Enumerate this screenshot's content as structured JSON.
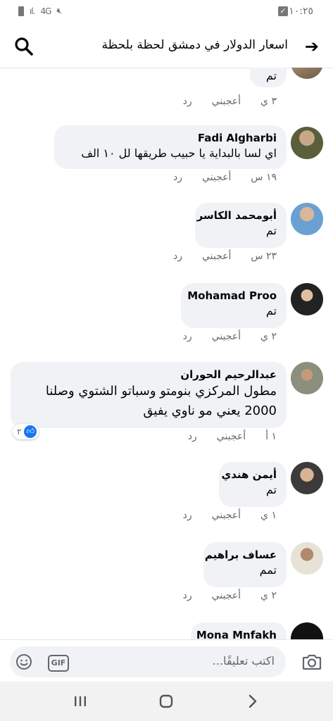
{
  "status": {
    "time": "١٠:٢٥",
    "network": "4G"
  },
  "header": {
    "title": "اسعار الدولار في دمشق لحظة بلحظة"
  },
  "comments": [
    {
      "name": "",
      "text": "تم",
      "time": "٣ ي",
      "like": "أعجبني",
      "reply": "رد"
    },
    {
      "name": "Fadi Algharbi",
      "text": "اي لسا بالبداية يا حبيب طريقها لل ١٠ الف",
      "time": "١٩ س",
      "like": "أعجبني",
      "reply": "رد"
    },
    {
      "name": "أبومحمد الكاسر",
      "text": "تم",
      "time": "٢٣ س",
      "like": "أعجبني",
      "reply": "رد"
    },
    {
      "name": "Mohamad Proo",
      "text": "تم",
      "time": "٢ ي",
      "like": "أعجبني",
      "reply": "رد"
    },
    {
      "name": "عبدالرحيم الحوران",
      "text": "مطول المركزي بنومتو وسباتو الشتوي وصلنا 2000 يعني مو ناوي يفيق",
      "time": "١ أ",
      "like": "أعجبني",
      "reply": "رد",
      "reactions": "٢"
    },
    {
      "name": "أيمن هندي",
      "text": "تم",
      "time": "١ ي",
      "like": "أعجبني",
      "reply": "رد"
    },
    {
      "name": "عساف براهيم",
      "text": "تمم",
      "time": "٢ ي",
      "like": "أعجبني",
      "reply": "رد"
    },
    {
      "name": "Mona Mnfakh",
      "text": "",
      "time": "",
      "like": "",
      "reply": ""
    }
  ],
  "composer": {
    "placeholder": "اكتب تعليقًا...",
    "gif_label": "GIF"
  },
  "colors": {
    "bubble": "#f0f2f5",
    "accent": "#1877f2",
    "meta": "#65676b"
  }
}
